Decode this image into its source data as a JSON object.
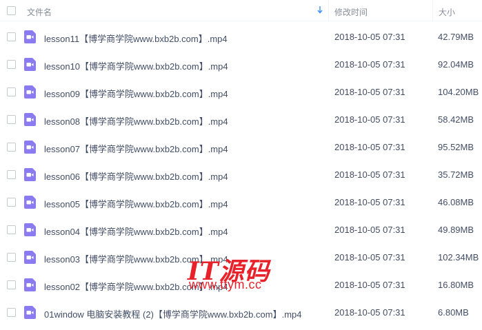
{
  "header": {
    "name_label": "文件名",
    "time_label": "修改时间",
    "size_label": "大小",
    "sort_icon": "sort-arrow-down-icon",
    "accent_color": "#3b8cff"
  },
  "files": [
    {
      "name": "lesson11【博学商学院www.bxb2b.com】.mp4",
      "time": "2018-10-05 07:31",
      "size": "42.79MB"
    },
    {
      "name": "lesson10【博学商学院www.bxb2b.com】.mp4",
      "time": "2018-10-05 07:31",
      "size": "92.04MB"
    },
    {
      "name": "lesson09【博学商学院www.bxb2b.com】.mp4",
      "time": "2018-10-05 07:31",
      "size": "104.20MB"
    },
    {
      "name": "lesson08【博学商学院www.bxb2b.com】.mp4",
      "time": "2018-10-05 07:31",
      "size": "58.42MB"
    },
    {
      "name": "lesson07【博学商学院www.bxb2b.com】.mp4",
      "time": "2018-10-05 07:31",
      "size": "95.52MB"
    },
    {
      "name": "lesson06【博学商学院www.bxb2b.com】.mp4",
      "time": "2018-10-05 07:31",
      "size": "35.72MB"
    },
    {
      "name": "lesson05【博学商学院www.bxb2b.com】.mp4",
      "time": "2018-10-05 07:31",
      "size": "46.08MB"
    },
    {
      "name": "lesson04【博学商学院www.bxb2b.com】.mp4",
      "time": "2018-10-05 07:31",
      "size": "49.89MB"
    },
    {
      "name": "lesson03【博学商学院www.bxb2b.com】.mp4",
      "time": "2018-10-05 07:31",
      "size": "102.34MB"
    },
    {
      "name": "lesson02【博学商学院www.bxb2b.com】.mp4",
      "time": "2018-10-05 07:31",
      "size": "16.80MB"
    },
    {
      "name": "01window 电脑安装教程 (2)【博学商学院www.bxb2b.com】.mp4",
      "time": "2018-10-05 07:31",
      "size": "6.80MB"
    }
  ],
  "file_icon": "video-file-icon",
  "file_icon_color": "#8a7cf0",
  "watermark": {
    "logo": "IT源码",
    "url": "www.ttym.cc",
    "color": "#e8222a"
  }
}
